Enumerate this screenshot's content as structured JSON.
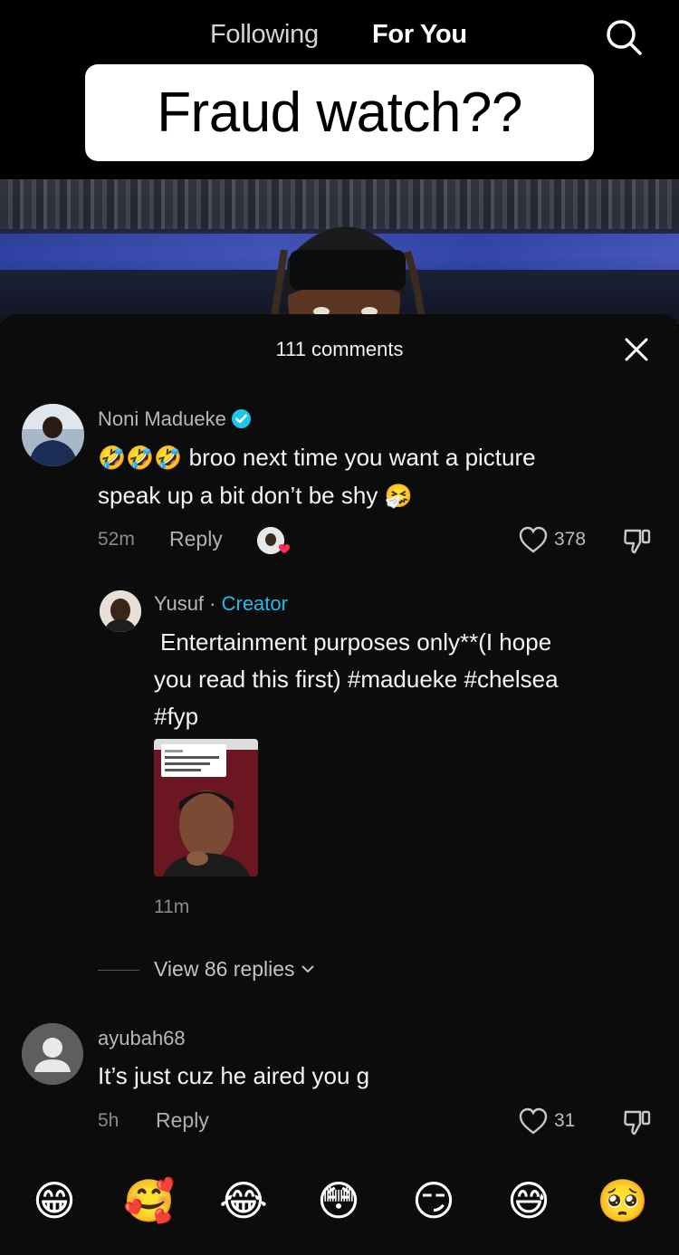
{
  "nav": {
    "following": "Following",
    "for_you": "For You"
  },
  "video": {
    "caption": "Fraud watch??"
  },
  "comments_panel": {
    "title": "111 comments",
    "comments": [
      {
        "username": "Noni Madueke",
        "verified": true,
        "emojis": "🤣🤣🤣",
        "text_line1": "broo next time you want a picture",
        "text_line2": "speak up a bit don’t be shy",
        "trailing_emoji": "🤧",
        "time": "52m",
        "reply_label": "Reply",
        "likes": "378"
      },
      {
        "username": "Yusuf",
        "separator": " · ",
        "creator_label": "Creator",
        "text_line1": "Entertainment purposes only**(I hope",
        "text_line2": "you read this first) #madueke #chelsea",
        "text_line3": "#fyp",
        "time": "11m"
      },
      {
        "username": "ayubah68",
        "text": "It’s just cuz he aired you g",
        "time": "5h",
        "reply_label": "Reply",
        "likes": "31"
      }
    ],
    "view_replies": "View 86 replies"
  },
  "quick_emojis": [
    "😁",
    "🥰",
    "😂",
    "😳",
    "😏",
    "😅",
    "🥺"
  ],
  "colors": {
    "accent_creator": "#27b8e6",
    "verified": "#20c5ea",
    "panel_bg": "#0c0c0c"
  }
}
